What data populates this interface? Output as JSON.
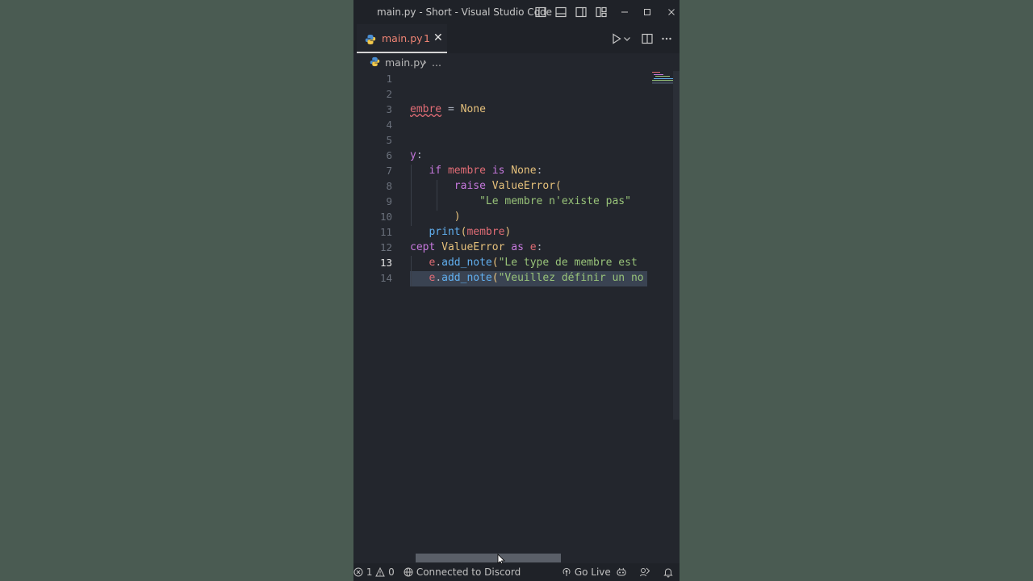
{
  "window": {
    "title": "main.py - Short - Visual Studio Code"
  },
  "tab": {
    "name": "main.py",
    "problem_count": "1",
    "close_glyph": "✕"
  },
  "breadcrumb": {
    "file": "main.py",
    "separator": "›",
    "more": "..."
  },
  "editor": {
    "line_numbers": [
      "1",
      "2",
      "3",
      "4",
      "5",
      "6",
      "7",
      "8",
      "9",
      "10",
      "11",
      "12",
      "13",
      "14"
    ],
    "active_line": "13",
    "lines": {
      "l3": [
        {
          "t": "embre",
          "c": "v err"
        },
        {
          "t": " = ",
          "c": "p"
        },
        {
          "t": "None",
          "c": "n"
        }
      ],
      "l6": [
        {
          "t": "y",
          "c": "k"
        },
        {
          "t": ":",
          "c": "p"
        }
      ],
      "l7": [
        {
          "t": "   ",
          "c": "p"
        },
        {
          "t": "if",
          "c": "k"
        },
        {
          "t": " membre ",
          "c": "v"
        },
        {
          "t": "is",
          "c": "k"
        },
        {
          "t": " ",
          "c": "p"
        },
        {
          "t": "None",
          "c": "n"
        },
        {
          "t": ":",
          "c": "p"
        }
      ],
      "l8": [
        {
          "t": "       ",
          "c": "p"
        },
        {
          "t": "raise",
          "c": "k"
        },
        {
          "t": " ",
          "c": "p"
        },
        {
          "t": "ValueError",
          "c": "y"
        },
        {
          "t": "(",
          "c": "y"
        }
      ],
      "l9": [
        {
          "t": "           ",
          "c": "p"
        },
        {
          "t": "\"Le membre n'existe pas\"",
          "c": "s"
        }
      ],
      "l10": [
        {
          "t": "       ",
          "c": "p"
        },
        {
          "t": ")",
          "c": "y"
        }
      ],
      "l11": [
        {
          "t": "   ",
          "c": "p"
        },
        {
          "t": "print",
          "c": "f"
        },
        {
          "t": "(",
          "c": "y"
        },
        {
          "t": "membre",
          "c": "v"
        },
        {
          "t": ")",
          "c": "y"
        }
      ],
      "l12": [
        {
          "t": "cept",
          "c": "k"
        },
        {
          "t": " ",
          "c": "p"
        },
        {
          "t": "ValueError",
          "c": "y"
        },
        {
          "t": " ",
          "c": "p"
        },
        {
          "t": "as",
          "c": "k"
        },
        {
          "t": " e",
          "c": "v"
        },
        {
          "t": ":",
          "c": "p"
        }
      ],
      "l13": [
        {
          "t": "   ",
          "c": "p"
        },
        {
          "t": "e",
          "c": "v"
        },
        {
          "t": ".",
          "c": "p"
        },
        {
          "t": "add_note",
          "c": "f"
        },
        {
          "t": "(",
          "c": "y"
        },
        {
          "t": "\"Le type de membre est",
          "c": "s"
        }
      ],
      "l14": [
        {
          "t": "   ",
          "c": "p"
        },
        {
          "t": "e",
          "c": "v"
        },
        {
          "t": ".",
          "c": "p"
        },
        {
          "t": "add_note",
          "c": "f"
        },
        {
          "t": "(",
          "c": "y"
        },
        {
          "t": "\"Veuillez définir un no",
          "c": "s"
        }
      ]
    }
  },
  "statusbar": {
    "errors": "1",
    "warnings": "0",
    "discord": "Connected to Discord",
    "go_live": "Go Live"
  },
  "colors": {
    "keyword": "#c678dd",
    "string": "#98c379",
    "function": "#61afef",
    "variable": "#e06c75",
    "constant": "#e5c07b",
    "tab_error": "#f08474"
  }
}
